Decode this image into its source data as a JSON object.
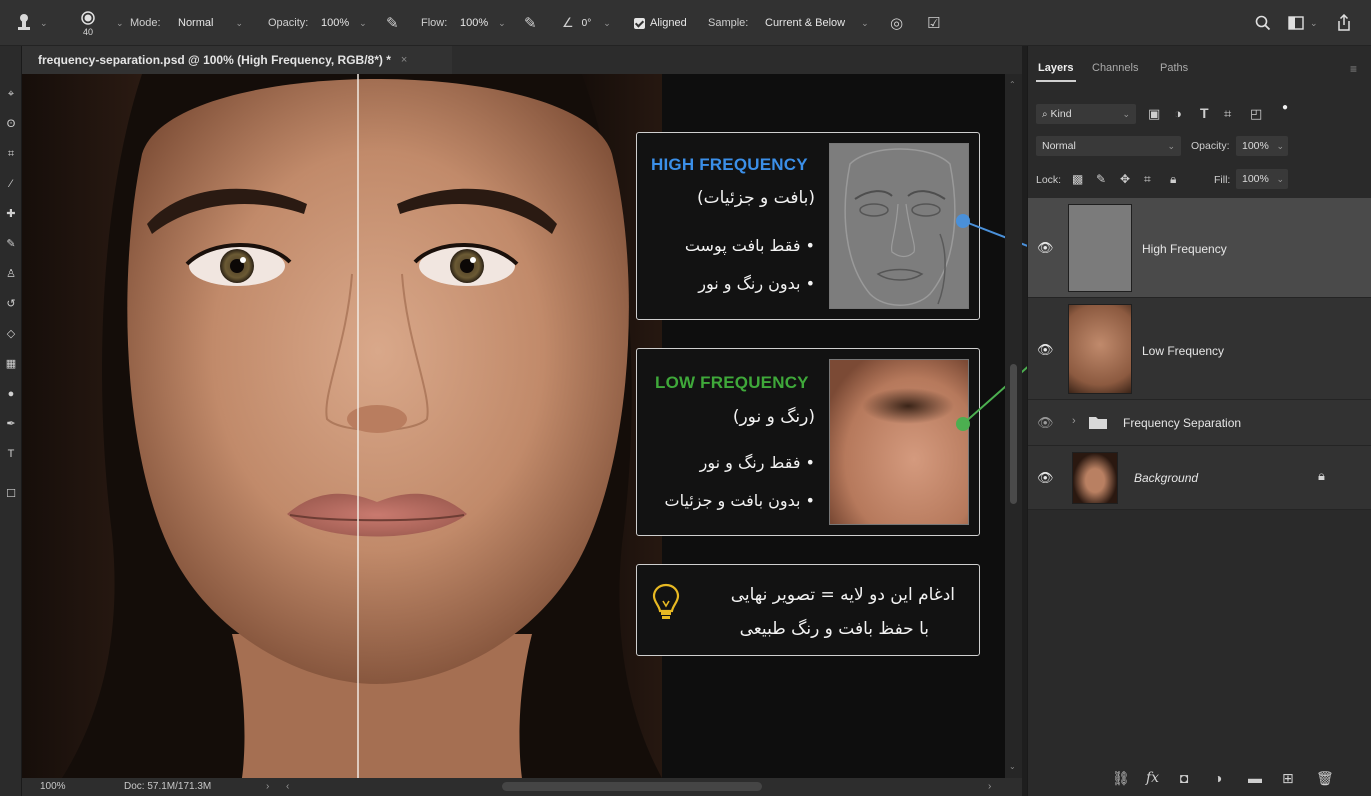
{
  "options_bar": {
    "brush_size": "40",
    "mode_label": "Mode:",
    "mode_value": "Normal",
    "opacity_label": "Opacity:",
    "opacity_value": "100%",
    "flow_label": "Flow:",
    "flow_value": "100%",
    "angle_value": "0°",
    "aligned_label": "Aligned",
    "aligned_checked": true,
    "sample_label": "Sample:",
    "sample_value": "Current & Below"
  },
  "document": {
    "tab_title": "frequency-separation.psd @ 100% (High Frequency, RGB/8*) *",
    "tab_close": "×"
  },
  "status_bar": {
    "zoom": "100%",
    "doc_size": "Doc: 57.1M/171.3M"
  },
  "overlay": {
    "high_card": {
      "title": "HIGH FREQUENCY",
      "subtitle": "(بافت و جزئیات)",
      "bullet1": "• فقط بافت پوست",
      "bullet2": "• بدون رنگ و نور",
      "accent_color": "#3b8fe8",
      "connector_color": "#4a90d9"
    },
    "low_card": {
      "title": "LOW FREQUENCY",
      "subtitle": "(رنگ و نور)",
      "bullet1": "• فقط رنگ و نور",
      "bullet2": "• بدون بافت و جزئیات",
      "accent_color": "#3fa83a",
      "connector_color": "#4caf50"
    },
    "note_card": {
      "line1": "ادغام این دو لایه = تصویر نهایی",
      "line2": "با حفظ بافت و رنگ طبیعی",
      "icon": "lightbulb-icon",
      "icon_color": "#e8b923"
    }
  },
  "layers_panel": {
    "tabs": [
      "Layers",
      "Channels",
      "Paths"
    ],
    "active_tab": "Layers",
    "filter_kind": "Kind",
    "blend_mode": "Normal",
    "opacity_label": "Opacity:",
    "opacity_value": "100%",
    "lock_label": "Lock:",
    "fill_label": "Fill:",
    "fill_value": "100%",
    "layers": [
      {
        "name": "High Frequency",
        "visible": true,
        "selected": true
      },
      {
        "name": "Low Frequency",
        "visible": true,
        "selected": false
      },
      {
        "name": "Frequency Separation",
        "visible": false,
        "selected": false,
        "type": "group"
      },
      {
        "name": "Background",
        "visible": true,
        "selected": false,
        "locked": true
      }
    ],
    "footer_icons": [
      "link-icon",
      "fx-icon",
      "mask-icon",
      "adjustment-icon",
      "folder-icon",
      "new-layer-icon",
      "trash-icon"
    ]
  }
}
